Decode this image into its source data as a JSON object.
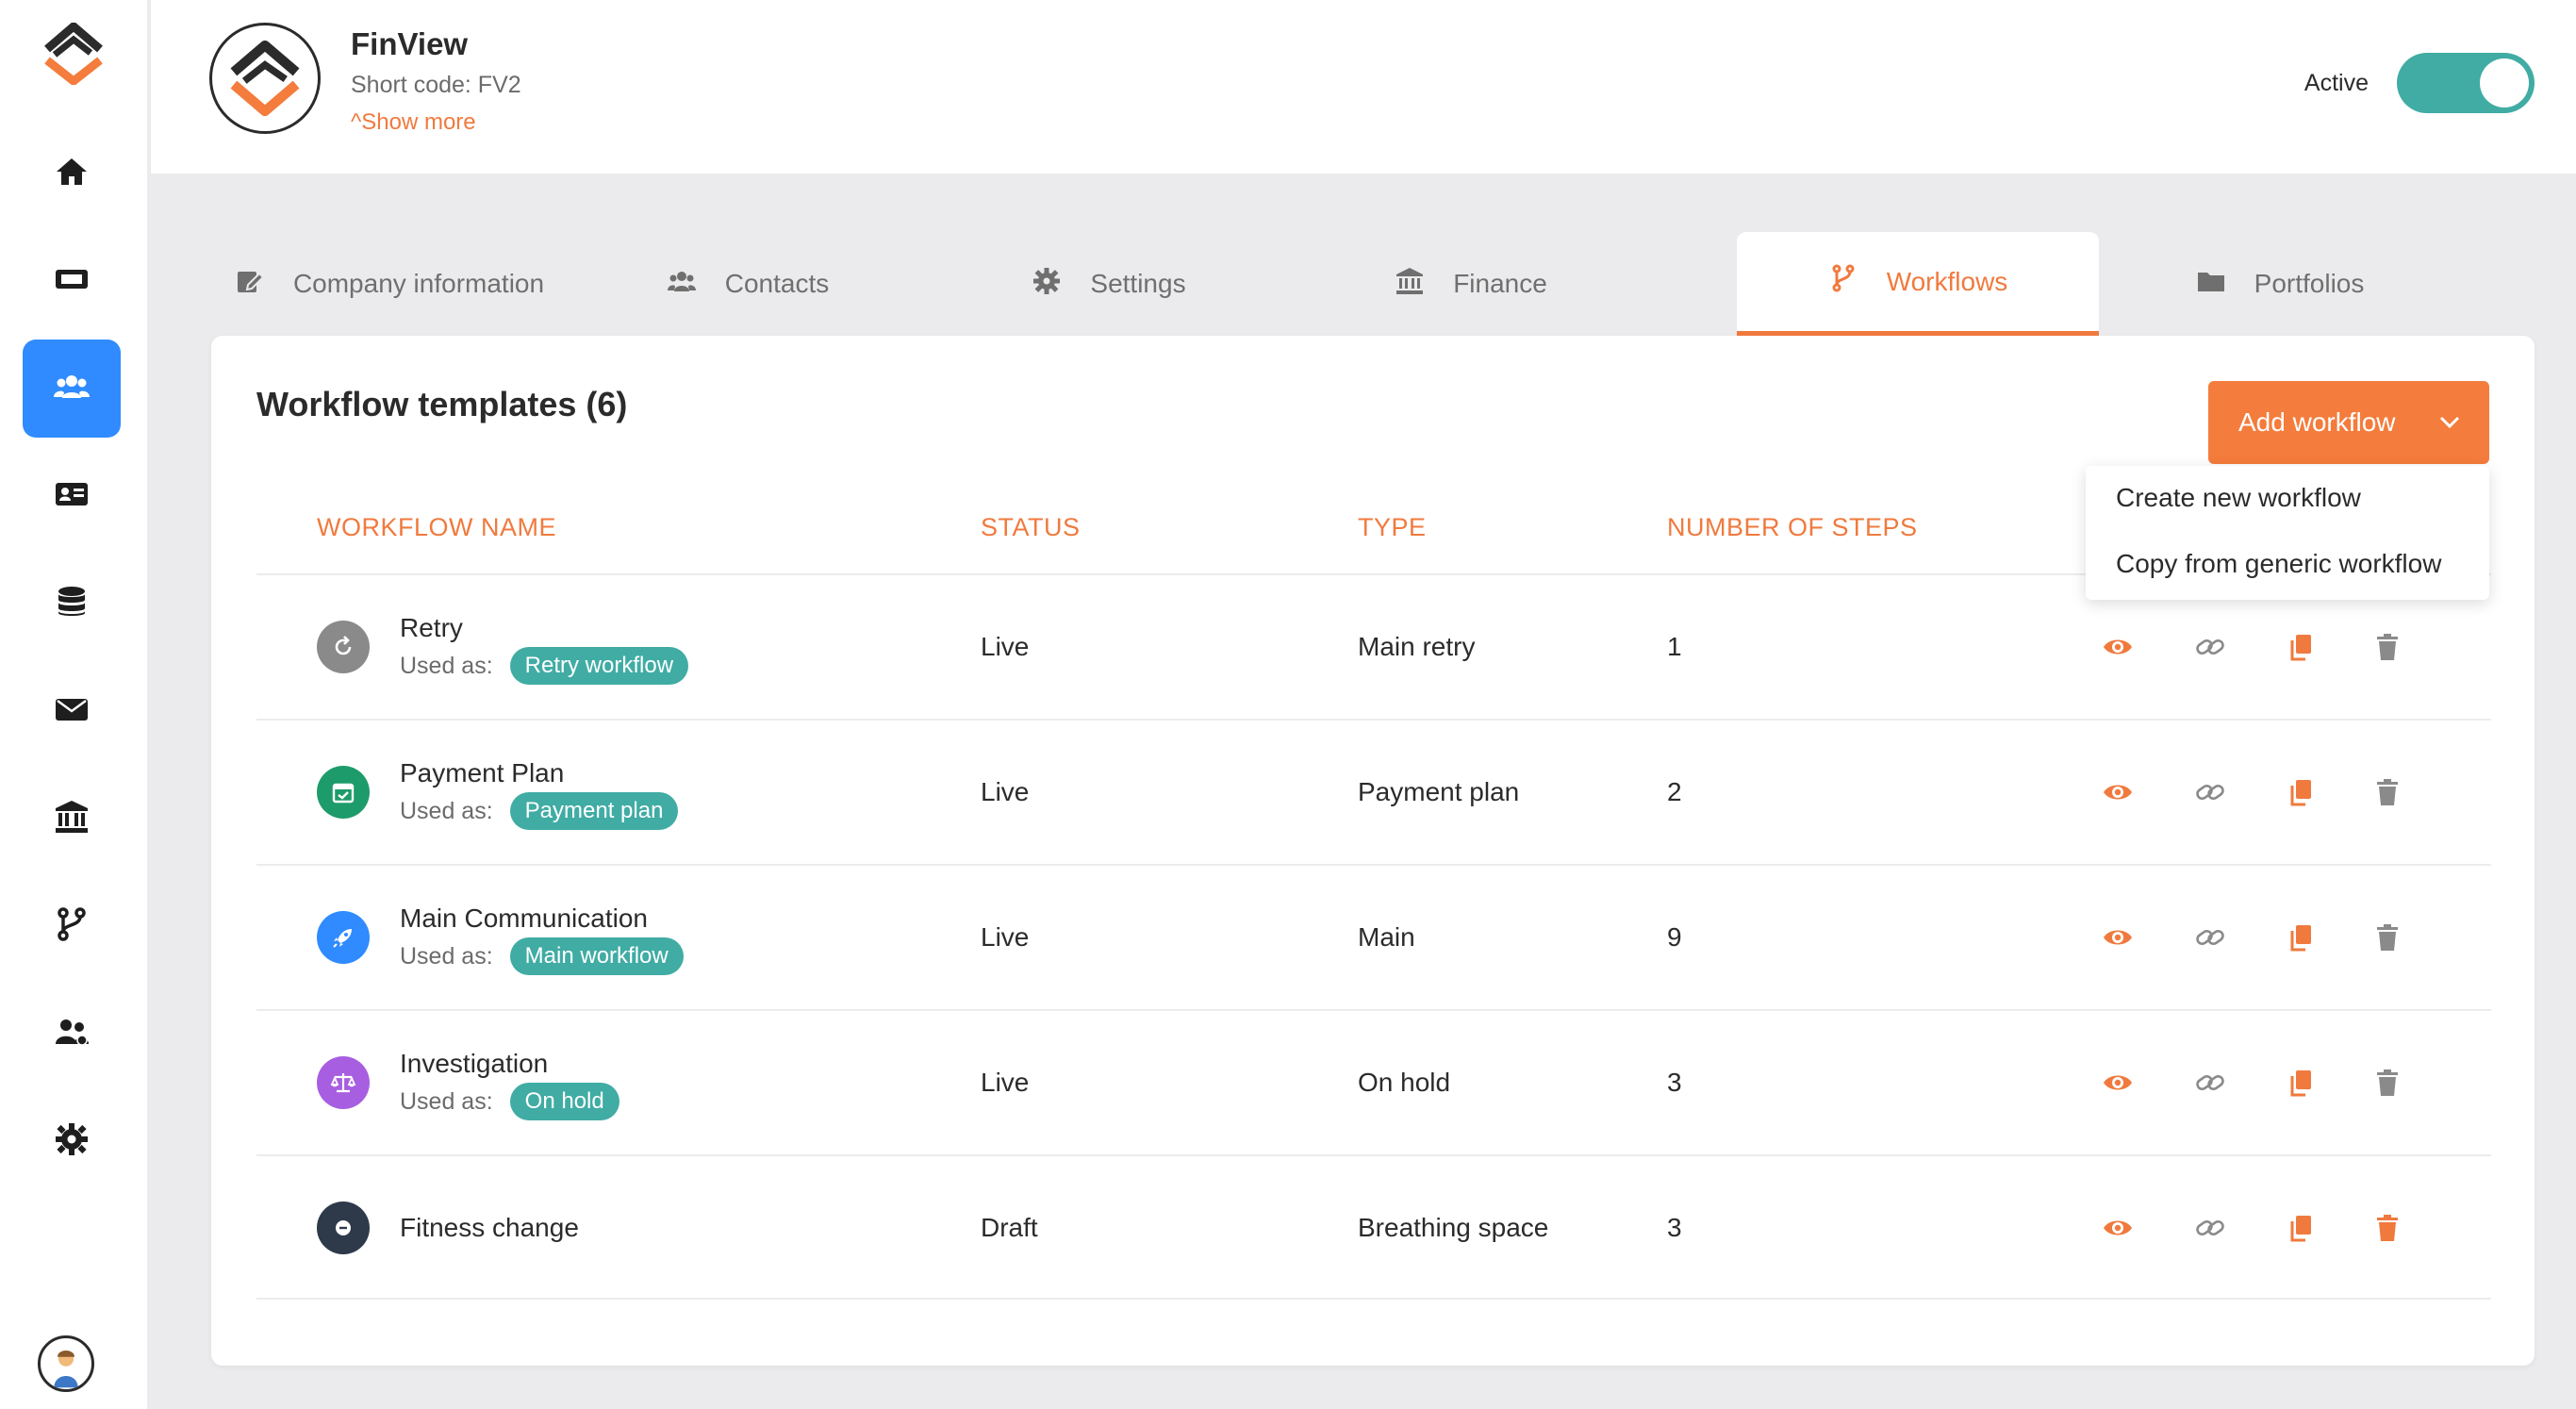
{
  "colors": {
    "accent": "#f07a3e",
    "sidebar_active": "#2f8bff",
    "toggle_on": "#40aca4",
    "badge": "#40aca4"
  },
  "sidebar": {
    "items": [
      {
        "icon": "home-icon"
      },
      {
        "icon": "ticket-icon"
      },
      {
        "icon": "users-icon",
        "active": true
      },
      {
        "icon": "id-card-icon"
      },
      {
        "icon": "database-icon"
      },
      {
        "icon": "envelope-icon"
      },
      {
        "icon": "bank-icon"
      },
      {
        "icon": "branch-icon"
      },
      {
        "icon": "user-group-icon"
      },
      {
        "icon": "gear-icon"
      }
    ]
  },
  "header": {
    "brand_name": "FinView",
    "short_code": "Short code: FV2",
    "show_more": "Show more",
    "active_label": "Active",
    "active_on": true
  },
  "tabs": [
    {
      "label": "Company information",
      "icon": "edit-icon"
    },
    {
      "label": "Contacts",
      "icon": "users-icon"
    },
    {
      "label": "Settings",
      "icon": "gear-icon"
    },
    {
      "label": "Finance",
      "icon": "bank-icon"
    },
    {
      "label": "Workflows",
      "icon": "branch-icon",
      "active": true
    },
    {
      "label": "Portfolios",
      "icon": "folder-icon"
    }
  ],
  "card": {
    "title": "Workflow templates (6)",
    "add_button": "Add workflow",
    "dropdown": [
      "Create new workflow",
      "Copy from generic workflow"
    ],
    "columns": [
      "WORKFLOW NAME",
      "STATUS",
      "TYPE",
      "NUMBER OF STEPS"
    ],
    "used_as_label": "Used as:",
    "rows": [
      {
        "name": "Retry",
        "used_as": "Retry workflow",
        "status": "Live",
        "type": "Main retry",
        "steps": "1",
        "icon": "retry-icon",
        "icon_color": "#8a8a8a"
      },
      {
        "name": "Payment Plan",
        "used_as": "Payment plan",
        "status": "Live",
        "type": "Payment plan",
        "steps": "2",
        "icon": "calendar-icon",
        "icon_color": "#1e9b6b"
      },
      {
        "name": "Main Communication",
        "used_as": "Main workflow",
        "status": "Live",
        "type": "Main",
        "steps": "9",
        "icon": "rocket-icon",
        "icon_color": "#2f8bff"
      },
      {
        "name": "Investigation",
        "used_as": "On hold",
        "status": "Live",
        "type": "On hold",
        "steps": "3",
        "icon": "scale-icon",
        "icon_color": "#a75ee0"
      },
      {
        "name": "Fitness change",
        "used_as": "",
        "status": "Draft",
        "type": "Breathing space",
        "steps": "3",
        "icon": "minus-circle-icon",
        "icon_color": "#2e3a4a"
      }
    ]
  }
}
